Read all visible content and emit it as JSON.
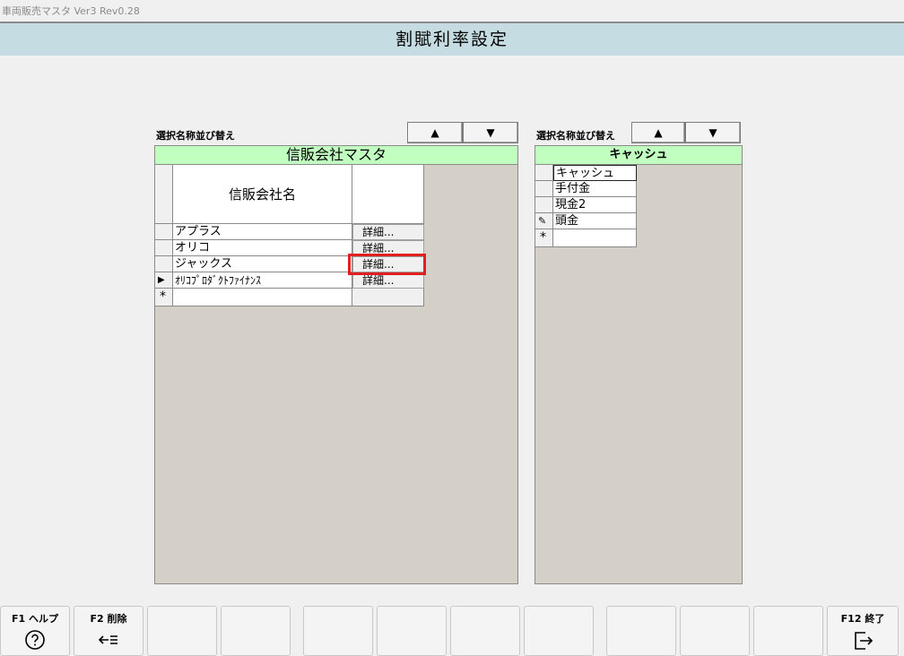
{
  "window": {
    "title": "車両販売マスタ Ver3 Rev0.28"
  },
  "header": {
    "title": "割賦利率設定"
  },
  "left": {
    "sort_label": "選択名称並び替え",
    "up_label": "▲",
    "down_label": "▼",
    "panel_title": "信販会社マスタ",
    "column_header": "信販会社名",
    "rows": [
      {
        "name": "アプラス",
        "detail": "詳細..."
      },
      {
        "name": "オリコ",
        "detail": "詳細..."
      },
      {
        "name": "ジャックス",
        "detail": "詳細..."
      },
      {
        "name": "ｵﾘｺﾌﾟﾛﾀﾞｸﾄﾌｧｲﾅﾝｽ",
        "detail": "詳細..."
      }
    ],
    "current_row_marker": "▶",
    "new_row_marker": "*"
  },
  "right": {
    "sort_label": "選択名称並び替え",
    "up_label": "▲",
    "down_label": "▼",
    "panel_title": "キャッシュ",
    "rows": [
      "キャッシュ",
      "手付金",
      "現金2",
      "頭金"
    ],
    "edit_marker": "✎",
    "new_row_marker": "*"
  },
  "fkeys": {
    "f1": {
      "label": "F1 ヘルプ",
      "icon": "help-circle-icon"
    },
    "f2": {
      "label": "F2 削除",
      "icon": "delete-back-icon"
    },
    "f12": {
      "label": "F12 終了",
      "icon": "exit-icon"
    }
  }
}
